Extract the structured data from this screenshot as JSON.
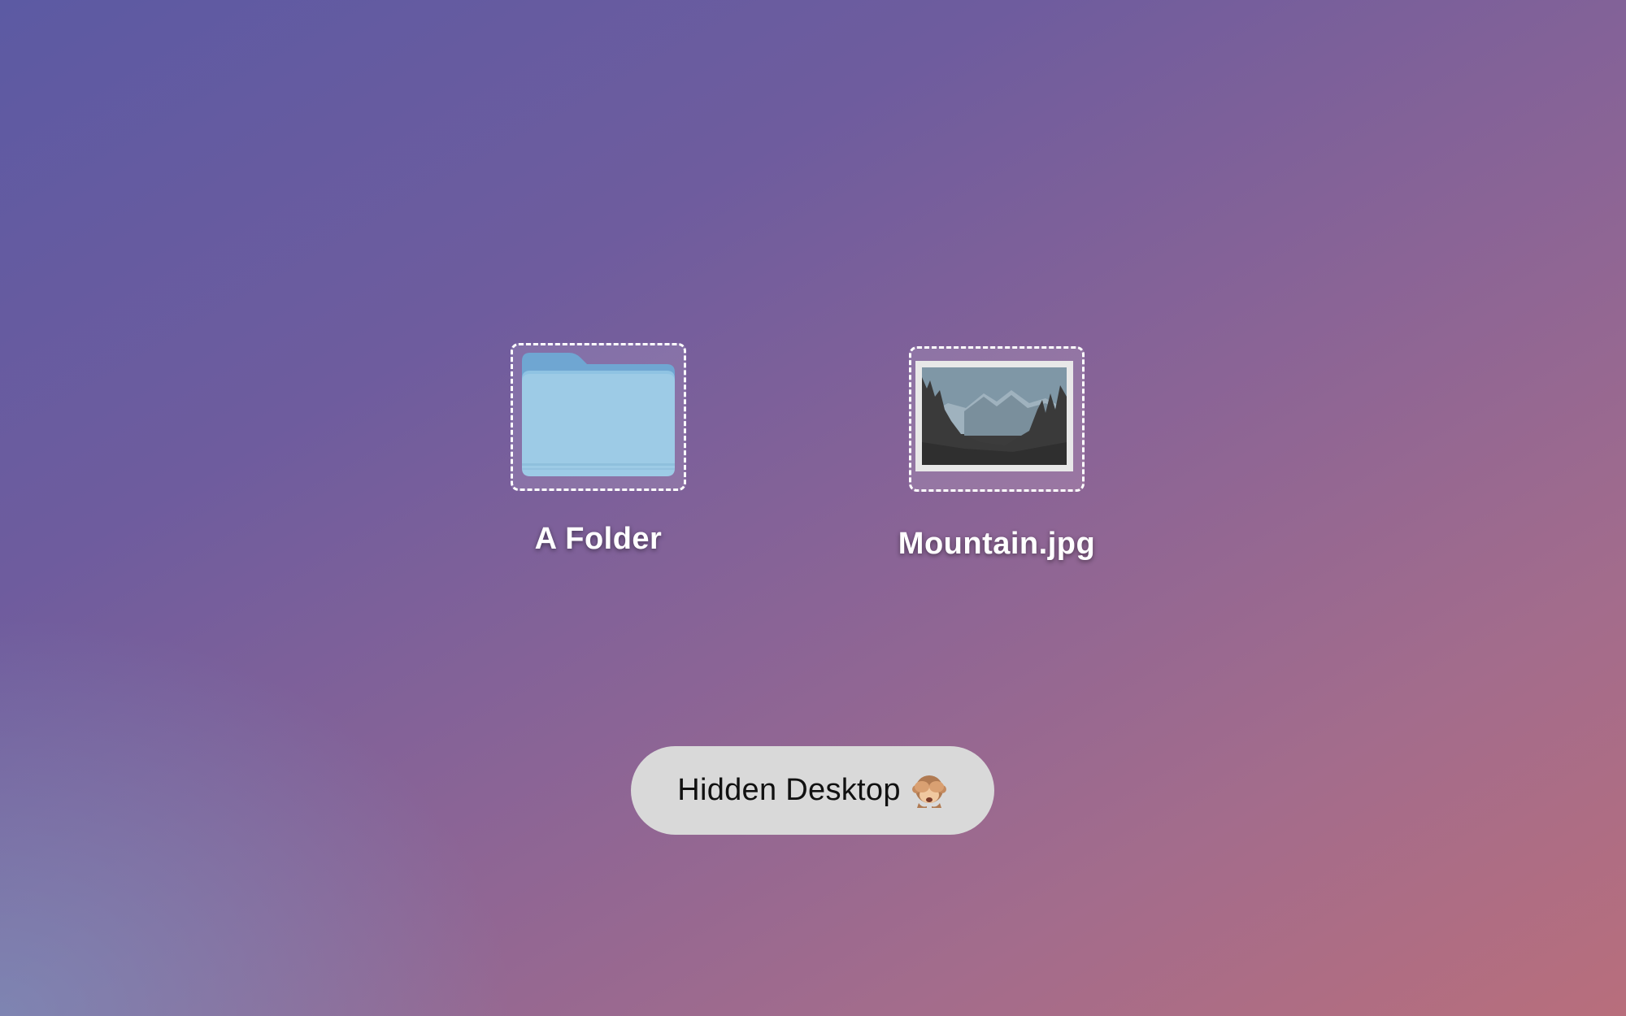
{
  "desktop": {
    "icons": [
      {
        "label": "A Folder",
        "kind": "folder-icon",
        "color": "#9ecbe6"
      },
      {
        "label": "Mountain.jpg",
        "kind": "image-thumbnail-icon"
      }
    ]
  },
  "pill": {
    "label": "Hidden Desktop",
    "emoji": "see-no-evil-monkey-icon"
  }
}
